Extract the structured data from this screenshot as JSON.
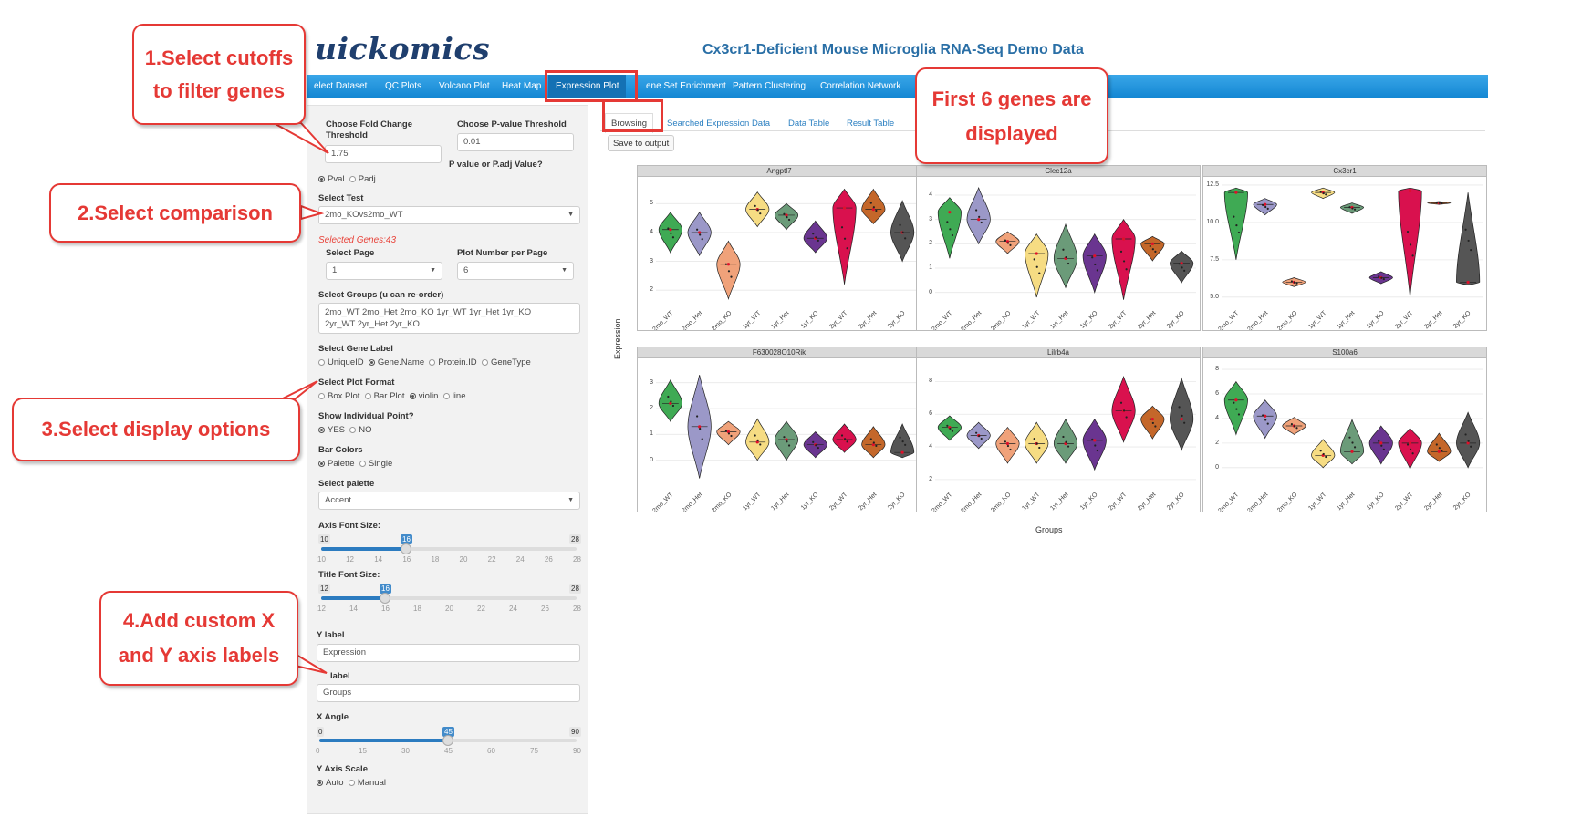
{
  "app": {
    "logo": "uickomics",
    "title": "Cx3cr1-Deficient Mouse Microglia RNA-Seq Demo Data"
  },
  "nav": {
    "items": [
      {
        "label": "elect Dataset"
      },
      {
        "label": "QC Plots"
      },
      {
        "label": "Volcano Plot"
      },
      {
        "label": "Heat Map"
      },
      {
        "label": "Expression Plot",
        "active": true
      },
      {
        "label": "ene Set Enrichment"
      },
      {
        "label": "Pattern Clustering"
      },
      {
        "label": "Correlation Network"
      }
    ]
  },
  "sidebar": {
    "fold_change_label": "Choose Fold Change Threshold",
    "fold_change_value": "1.75",
    "pvalue_label": "Choose P-value Threshold",
    "pvalue_value": "0.01",
    "pval_type_label": "P value or P.adj Value?",
    "pval_options": [
      "Pval",
      "Padj"
    ],
    "select_test_label": "Select Test",
    "select_test_value": "2mo_KOvs2mo_WT",
    "selected_genes": "Selected Genes:43",
    "select_page_label": "Select Page",
    "select_page_value": "1",
    "plot_number_label": "Plot Number per Page",
    "plot_number_value": "6",
    "select_groups_label": "Select Groups (u can re-order)",
    "groups_line1": "2mo_WT  2mo_Het  2mo_KO  1yr_WT  1yr_Het  1yr_KO",
    "groups_line2": "2yr_WT  2yr_Het  2yr_KO",
    "gene_label_label": "Select Gene Label",
    "gene_label_options": [
      "UniqueID",
      "Gene.Name",
      "Protein.ID",
      "GeneType"
    ],
    "plot_format_label": "Select Plot Format",
    "plot_format_options": [
      "Box Plot",
      "Bar Plot",
      "violin",
      "line"
    ],
    "show_points_label": "Show Individual Point?",
    "show_points_options": [
      "YES",
      "NO"
    ],
    "bar_colors_label": "Bar Colors",
    "bar_colors_options": [
      "Palette",
      "Single"
    ],
    "palette_label": "Select palette",
    "palette_value": "Accent",
    "axis_font_label": "Axis Font Size:",
    "axis_font": {
      "min": "10",
      "max": "28",
      "value": "16",
      "ticks": [
        "10",
        "12",
        "14",
        "16",
        "18",
        "20",
        "22",
        "24",
        "26",
        "28"
      ],
      "fraction": 0.333
    },
    "title_font_label": "Title Font Size:",
    "title_font": {
      "min": "12",
      "max": "28",
      "value": "16",
      "ticks": [
        "12",
        "14",
        "16",
        "18",
        "20",
        "22",
        "24",
        "26",
        "28"
      ],
      "fraction": 0.25
    },
    "y_label_label": "Y label",
    "y_label_value": "Expression",
    "x_label_label": "label",
    "x_label_value": "Groups",
    "x_angle_label": "X Angle",
    "x_angle": {
      "min": "0",
      "max": "90",
      "value": "45",
      "ticks": [
        "0",
        "15",
        "30",
        "45",
        "60",
        "75",
        "90"
      ],
      "fraction": 0.5
    },
    "y_scale_label": "Y Axis Scale",
    "y_scale_options": [
      "Auto",
      "Manual"
    ]
  },
  "tabs": [
    {
      "label": "Browsing",
      "active": true
    },
    {
      "label": "Searched Expression Data"
    },
    {
      "label": "Data Table"
    },
    {
      "label": "Result Table"
    }
  ],
  "save_button": "Save to output",
  "callouts": {
    "c1": [
      "1.Select cutoffs",
      "to filter genes"
    ],
    "c2": "2.Select comparison",
    "c3": "3.Select display options",
    "c4": [
      "4.Add custom X",
      "and Y axis labels"
    ],
    "c5": [
      "First 6 genes are",
      "displayed"
    ]
  },
  "chart_data": {
    "type": "violin",
    "ylabel": "Expression",
    "xlabel": "Groups",
    "categories": [
      "2mo_WT",
      "2mo_Het",
      "2mo_KO",
      "1yr_WT",
      "1yr_Het",
      "1yr_KO",
      "2yr_WT",
      "2yr_Het",
      "2yr_KO"
    ],
    "colors": [
      "#3faa54",
      "#9b98c8",
      "#f0a27a",
      "#f6dc83",
      "#6b9b79",
      "#6a3590",
      "#d9114e",
      "#c4672a",
      "#555555"
    ],
    "panels": [
      {
        "title": "Angptl7",
        "ylim": [
          1.5,
          5.8
        ],
        "yticks": [
          "2",
          "3",
          "4",
          "5"
        ],
        "medians": [
          4.1,
          4.0,
          2.9,
          4.8,
          4.6,
          3.8,
          4.85,
          4.8,
          4.0
        ],
        "mins": [
          3.3,
          3.2,
          1.7,
          4.2,
          4.1,
          3.3,
          2.2,
          4.3,
          3.0
        ],
        "maxs": [
          4.7,
          4.7,
          3.7,
          5.4,
          5.0,
          4.4,
          5.5,
          5.5,
          5.1
        ]
      },
      {
        "title": "Clec12a",
        "ylim": [
          -0.5,
          4.6
        ],
        "yticks": [
          "0",
          "1",
          "2",
          "3",
          "4"
        ],
        "medians": [
          3.3,
          3.0,
          2.1,
          1.6,
          1.4,
          1.5,
          2.2,
          2.0,
          1.2
        ],
        "mins": [
          1.4,
          2.0,
          1.6,
          -0.2,
          0.2,
          0.0,
          -0.3,
          1.3,
          0.4
        ],
        "maxs": [
          3.9,
          4.3,
          2.5,
          2.4,
          2.8,
          2.4,
          3.0,
          2.3,
          1.7
        ]
      },
      {
        "title": "Cx3cr1",
        "ylim": [
          4.5,
          12.8
        ],
        "yticks": [
          "5.0",
          "7.5",
          "10.0",
          "12.5"
        ],
        "medians": [
          12.0,
          11.2,
          6.0,
          12.0,
          11.0,
          6.3,
          12.1,
          11.3,
          6.0
        ],
        "mins": [
          7.5,
          10.5,
          5.7,
          11.6,
          10.6,
          5.9,
          5.0,
          11.2,
          5.8
        ],
        "maxs": [
          12.3,
          11.6,
          6.3,
          12.3,
          11.3,
          6.7,
          12.3,
          11.4,
          12.0
        ]
      },
      {
        "title": "F630028O10Rik",
        "ylim": [
          -1.0,
          3.8
        ],
        "yticks": [
          "0",
          "1",
          "2",
          "3"
        ],
        "medians": [
          2.2,
          1.3,
          1.1,
          0.7,
          0.8,
          0.6,
          0.8,
          0.6,
          0.3
        ],
        "mins": [
          1.5,
          -0.7,
          0.6,
          0.0,
          0.0,
          0.1,
          0.3,
          0.1,
          0.1
        ],
        "maxs": [
          3.1,
          3.3,
          1.5,
          1.6,
          1.5,
          1.1,
          1.4,
          1.3,
          1.4
        ]
      },
      {
        "title": "Lilrb4a",
        "ylim": [
          1.6,
          9.2
        ],
        "yticks": [
          "2",
          "4",
          "6",
          "8"
        ],
        "medians": [
          5.2,
          4.7,
          4.2,
          4.2,
          4.2,
          4.4,
          6.2,
          5.7,
          5.7
        ],
        "mins": [
          4.4,
          3.9,
          3.0,
          3.0,
          3.0,
          2.6,
          4.3,
          4.5,
          3.8
        ],
        "maxs": [
          5.9,
          5.5,
          5.2,
          5.5,
          5.7,
          5.7,
          8.3,
          6.5,
          8.2
        ]
      },
      {
        "title": "S100a6",
        "ylim": [
          -1.5,
          8.6
        ],
        "yticks": [
          "0",
          "2",
          "4",
          "6",
          "8"
        ],
        "medians": [
          5.5,
          4.2,
          3.4,
          1.0,
          1.3,
          2.0,
          2.0,
          1.3,
          2.0
        ],
        "mins": [
          2.7,
          2.4,
          2.7,
          0.0,
          0.3,
          0.3,
          -0.1,
          0.5,
          0.0
        ],
        "maxs": [
          7.0,
          5.5,
          4.1,
          2.3,
          3.9,
          3.4,
          3.2,
          2.8,
          4.5
        ]
      }
    ]
  }
}
